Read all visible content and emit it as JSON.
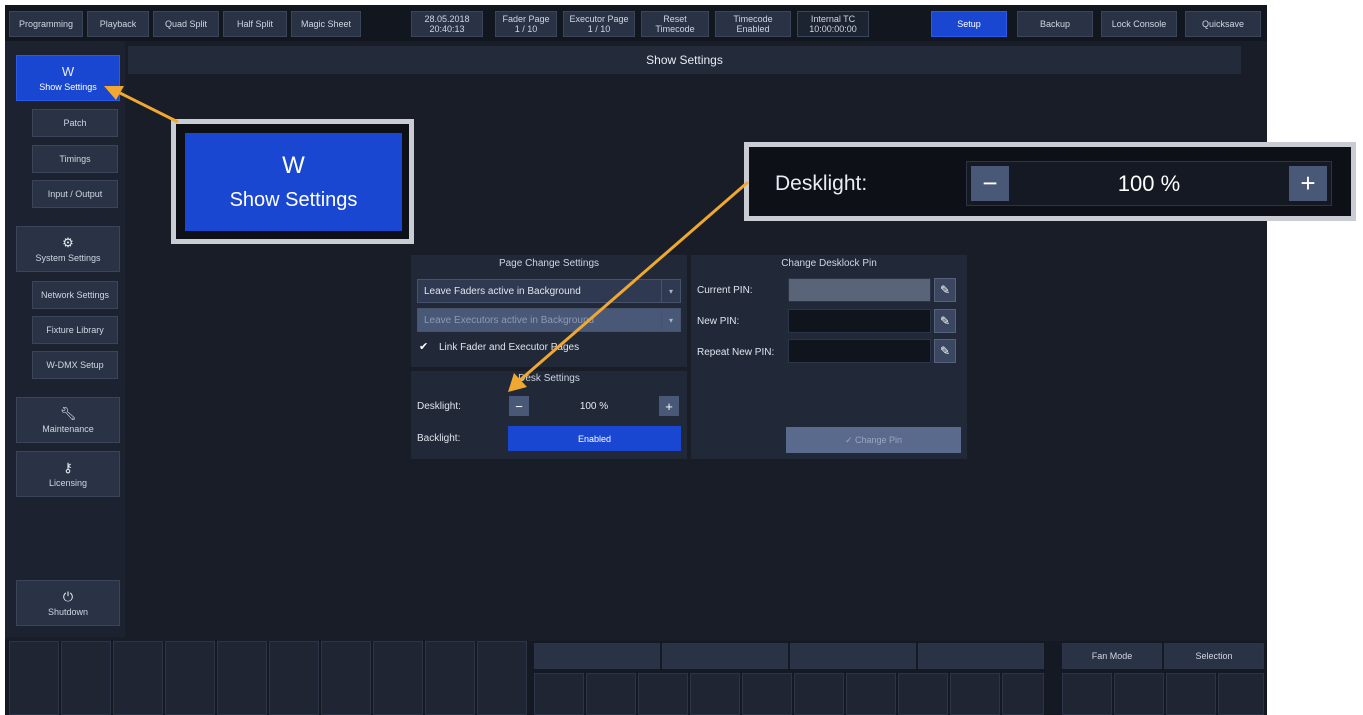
{
  "topbar": {
    "tabs": [
      "Programming",
      "Playback",
      "Quad Split",
      "Half Split",
      "Magic Sheet"
    ],
    "date": "28.05.2018",
    "time": "20:40:13",
    "fader_page_label": "Fader Page",
    "fader_page_value": "1 / 10",
    "executor_page_label": "Executor Page",
    "executor_page_value": "1 / 10",
    "reset_label_1": "Reset",
    "reset_label_2": "Timecode",
    "timecode_label": "Timecode",
    "timecode_value": "Enabled",
    "internal_tc_label": "Internal TC",
    "internal_tc_value": "10:00:00:00",
    "right_buttons": [
      "Setup",
      "Backup",
      "Lock Console",
      "Quicksave"
    ]
  },
  "sidebar": {
    "show_settings": "Show Settings",
    "patch": "Patch",
    "timings": "Timings",
    "input_output": "Input / Output",
    "system_settings": "System Settings",
    "network_settings": "Network Settings",
    "fixture_library": "Fixture Library",
    "wdmx_setup": "W-DMX Setup",
    "maintenance": "Maintenance",
    "licensing": "Licensing",
    "shutdown": "Shutdown"
  },
  "main": {
    "title": "Show Settings",
    "page_change": {
      "title": "Page Change Settings",
      "faders_option": "Leave Faders active in Background",
      "executors_option": "Leave Executors active in Background",
      "link_label": "Link Fader and Executor Pages",
      "link_checked": true
    },
    "desk_settings": {
      "title": "Desk Settings",
      "desklight_label": "Desklight:",
      "desklight_value": "100 %",
      "backlight_label": "Backlight:",
      "backlight_value": "Enabled"
    },
    "pin": {
      "title": "Change Desklock Pin",
      "current_label": "Current PIN:",
      "new_label": "New PIN:",
      "repeat_label": "Repeat New PIN:",
      "change_button": "✓ Change Pin"
    }
  },
  "bottom": {
    "fan_mode": "Fan Mode",
    "selection": "Selection"
  },
  "callouts": {
    "show_settings_big": "Show Settings",
    "desklight_big_label": "Desklight:",
    "desklight_big_value": "100 %"
  },
  "colors": {
    "accent_blue": "#1a47d1",
    "arrow_orange": "#f0a830",
    "background": "#181d28"
  }
}
